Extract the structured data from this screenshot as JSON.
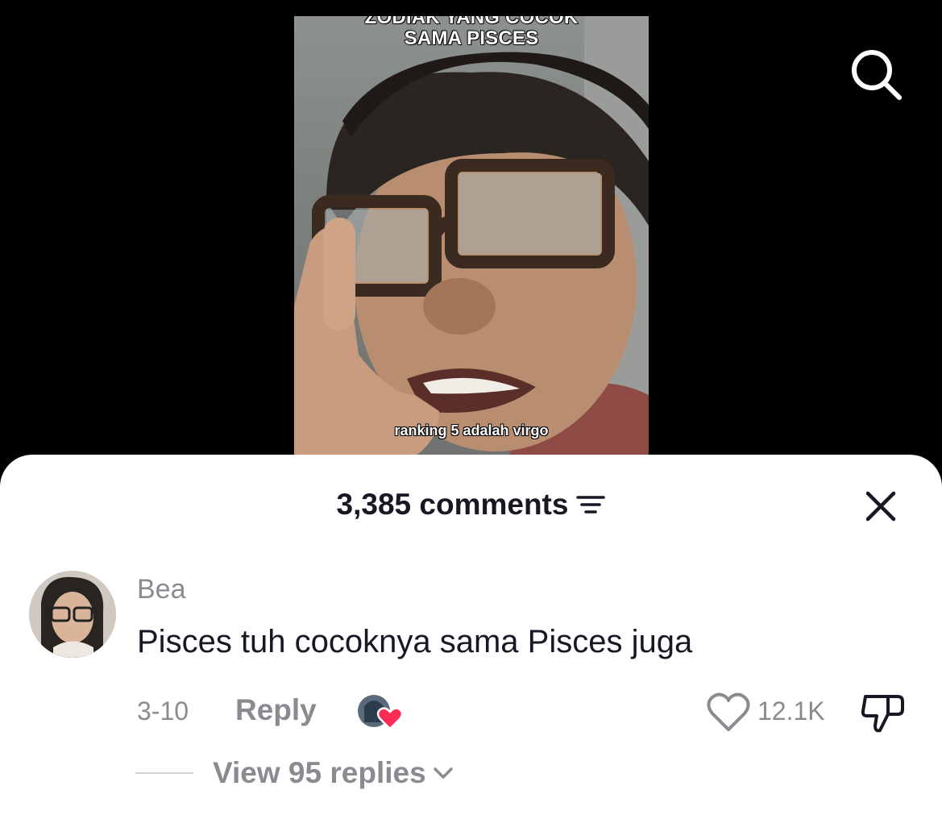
{
  "video": {
    "title_line1": "ZODIAK YANG COCOK",
    "title_line2": "SAMA PISCES",
    "subtitle": "ranking 5 adalah virgo"
  },
  "top_bar": {
    "search_icon": "search-icon"
  },
  "comments_sheet": {
    "count_label": "3,385 comments",
    "sort_icon": "filter-icon",
    "close_icon": "close-icon",
    "comment": {
      "author": "Bea",
      "text": "Pisces tuh cocoknya sama Pisces juga",
      "date": "3-10",
      "reply_label": "Reply",
      "creator_liked_icon": "creator-heart-avatar",
      "like_count": "12.1K",
      "view_replies_label": "View 95 replies"
    }
  },
  "colors": {
    "sheet_bg": "#ffffff",
    "text_primary": "#161823",
    "text_secondary": "#8a8b91",
    "heart": "#fe2c55"
  }
}
